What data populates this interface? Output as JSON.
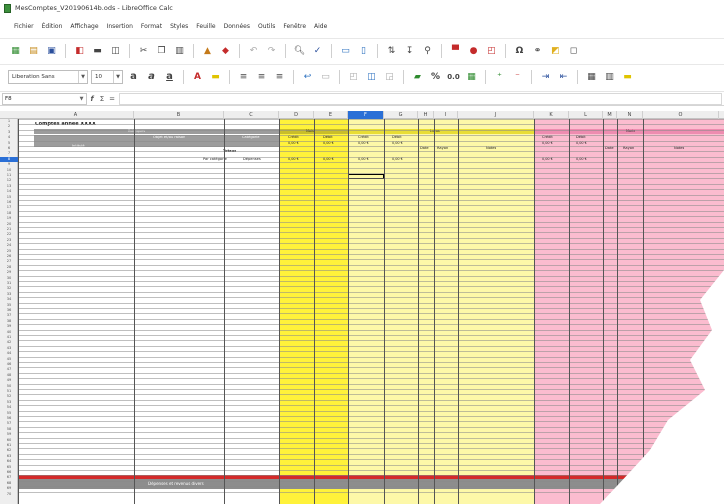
{
  "window": {
    "title": "MesComptes_V20190614b.ods - LibreOffice Calc"
  },
  "menu": [
    "Fichier",
    "Édition",
    "Affichage",
    "Insertion",
    "Format",
    "Styles",
    "Feuille",
    "Données",
    "Outils",
    "Fenêtre",
    "Aide"
  ],
  "toolbar": {
    "font_name": "Liberation Sans",
    "font_size": "10",
    "bold": "a",
    "italic": "a",
    "underline": "a",
    "percent": "%",
    "decimal": "0.0"
  },
  "formula_bar": {
    "cell_ref": "F8",
    "sum_symbol": "Σ",
    "equals_symbol": "="
  },
  "columns": [
    "A",
    "B",
    "C",
    "D",
    "E",
    "F",
    "G",
    "H",
    "I",
    "J",
    "K",
    "L",
    "M",
    "N",
    "O"
  ],
  "rows_visible": 70,
  "sheet": {
    "title": "Comptes année XXXX",
    "group_rubriques": "Rubriques",
    "group_mois": "Mois",
    "group_lucas": "Lucas",
    "group_marie": "Marie",
    "hdr_objet": "Objet et/ou raison",
    "hdr_categorie": "Catégorie",
    "hdr_intitule": "Intitulé",
    "hdr_credit": "Crédit",
    "hdr_debit": "Débit",
    "hdr_date": "Date",
    "hdr_rayon": "Rayon",
    "hdr_notes": "Notes",
    "label_totaux": "Totaux",
    "label_par_categorie": "Par catégorie",
    "label_depenses_cat": "Dépenses",
    "zero": "0,00 €",
    "footer": "Dépenses et revenus divers"
  },
  "colors": {
    "yellow": "#fff23a",
    "light_yellow": "#fdf8a8",
    "pink": "#f8a6c1",
    "light_pink": "#fbbccf",
    "header_grey": "#9c9c9c",
    "red": "#d42a2a"
  }
}
